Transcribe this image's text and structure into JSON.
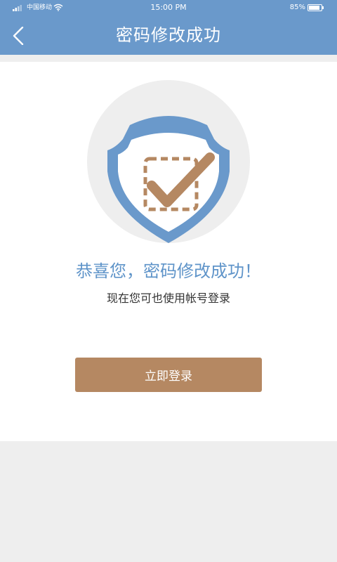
{
  "status_bar": {
    "carrier": "中国移动",
    "time": "15:00 PM",
    "battery": "85%",
    "icons": [
      "signal-icon",
      "wifi-icon",
      "battery-icon"
    ]
  },
  "header": {
    "title": "密码修改成功",
    "back_icon": "chevron-left-icon"
  },
  "content": {
    "graphic_icon": "shield-check-icon",
    "headline": "恭喜您，密码修改成功！",
    "subtext": "现在您可也使用帐号登录"
  },
  "actions": {
    "login_label": "立即登录"
  },
  "colors": {
    "header_bg": "#6a99cb",
    "shield_blue": "#6a99cb",
    "check_brown": "#b58862",
    "button_bg": "#b58862",
    "headline": "#5f94c9",
    "page_bg": "#eeeeee",
    "circle_bg": "#eeeeee"
  }
}
